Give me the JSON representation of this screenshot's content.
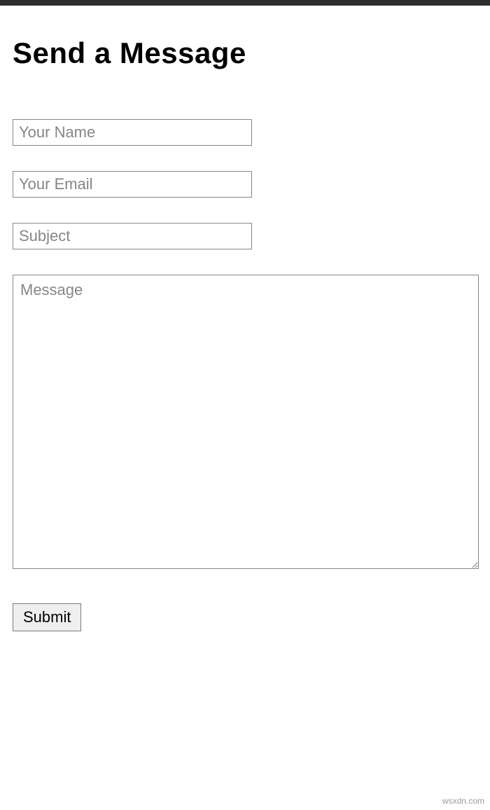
{
  "page": {
    "title": "Send a Message"
  },
  "form": {
    "name": {
      "placeholder": "Your Name",
      "value": ""
    },
    "email": {
      "placeholder": "Your Email",
      "value": ""
    },
    "subject": {
      "placeholder": "Subject",
      "value": ""
    },
    "message": {
      "placeholder": "Message",
      "value": ""
    },
    "submit_label": "Submit"
  },
  "watermark": "wsxdn.com"
}
